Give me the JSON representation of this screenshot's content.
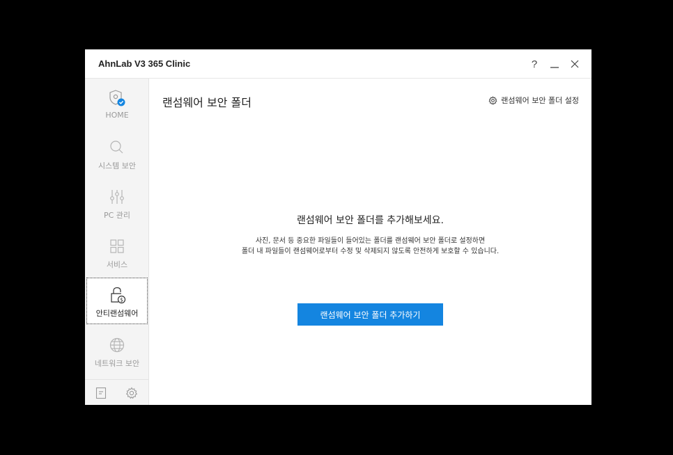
{
  "window": {
    "title": "AhnLab V3 365 Clinic",
    "controls": {
      "help": "?"
    }
  },
  "sidebar": {
    "items": [
      {
        "label": "HOME",
        "icon": "shield-check-icon",
        "active": false
      },
      {
        "label": "시스템 보안",
        "icon": "search-icon",
        "active": false
      },
      {
        "label": "PC 관리",
        "icon": "sliders-icon",
        "active": false
      },
      {
        "label": "서비스",
        "icon": "grid-icon",
        "active": false
      },
      {
        "label": "안티랜섬웨어",
        "icon": "lock-dollar-icon",
        "active": true
      },
      {
        "label": "네트워크 보안",
        "icon": "globe-icon",
        "active": false
      }
    ],
    "bottom": {
      "left_icon": "document-icon",
      "right_icon": "gear-icon"
    }
  },
  "main": {
    "title": "랜섬웨어 보안 폴더",
    "settings_link": "랜섬웨어 보안 폴더 설정",
    "empty_title": "랜섬웨어 보안 폴더를 추가해보세요.",
    "empty_desc_line1": "사진, 문서 등 중요한 파일들이 들어있는 폴더를 랜섬웨어 보안 폴더로 설정하면",
    "empty_desc_line2": "폴더 내 파일들이 랜섬웨어로부터 수정 및 삭제되지 않도록 안전하게 보호할 수 있습니다.",
    "add_button": "랜섬웨어 보안 폴더 추가하기"
  },
  "colors": {
    "accent": "#1485e0",
    "sidebar_bg": "#f4f4f4",
    "inactive_text": "#9a9a9a"
  }
}
